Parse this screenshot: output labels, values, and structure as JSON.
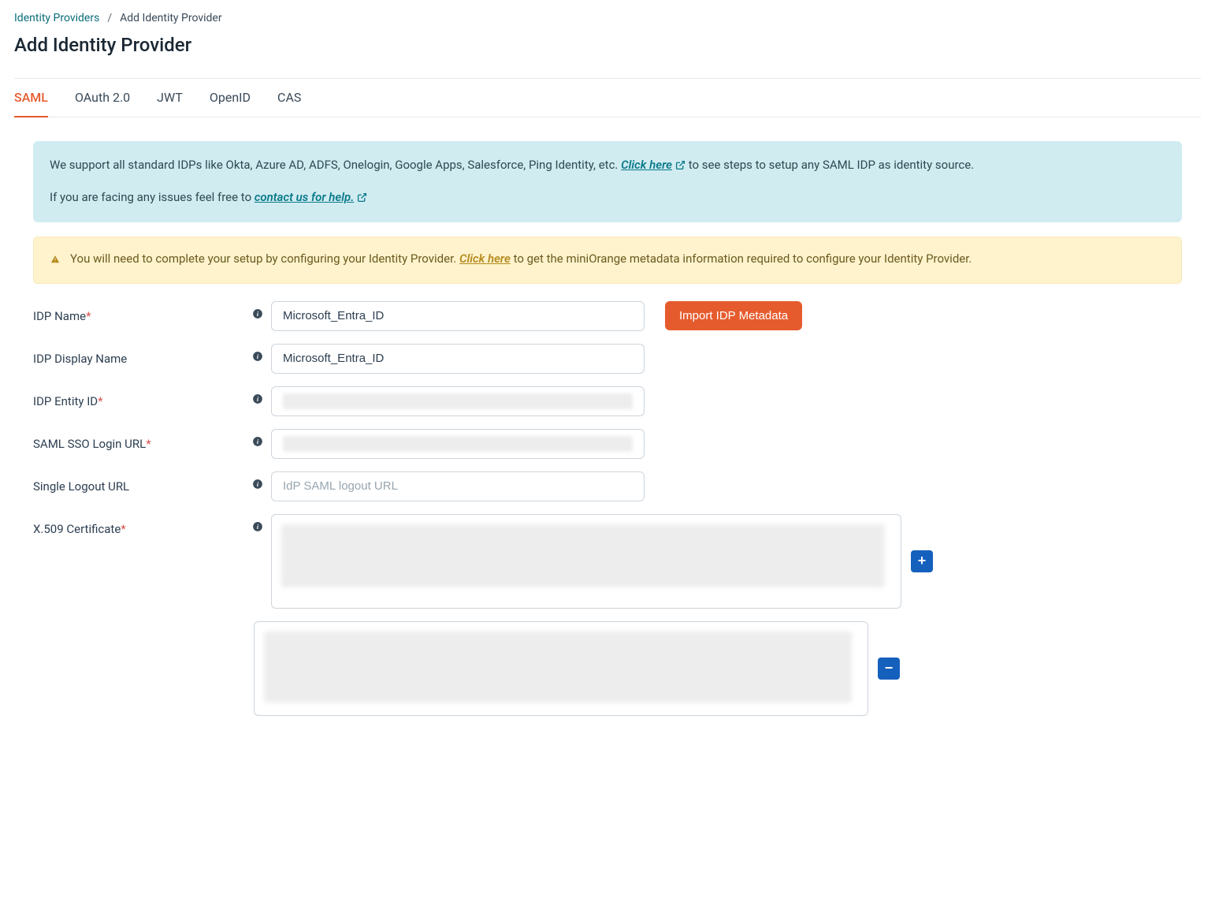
{
  "breadcrumb": {
    "link": "Identity Providers",
    "current": "Add Identity Provider"
  },
  "page_title": "Add Identity Provider",
  "tabs": [
    {
      "id": "saml",
      "label": "SAML",
      "active": true
    },
    {
      "id": "oauth",
      "label": "OAuth 2.0",
      "active": false
    },
    {
      "id": "jwt",
      "label": "JWT",
      "active": false
    },
    {
      "id": "openid",
      "label": "OpenID",
      "active": false
    },
    {
      "id": "cas",
      "label": "CAS",
      "active": false
    }
  ],
  "info_box": {
    "line1_pre": "We support all standard IDPs like Okta, Azure AD, ADFS, Onelogin, Google Apps, Salesforce, Ping Identity, etc. ",
    "link1": "Click here",
    "line1_post": " to see steps to setup any SAML IDP as identity source.",
    "line2_pre": "If you are facing any issues feel free to ",
    "link2": "contact us for help."
  },
  "warning_box": {
    "text_pre": "You will need to complete your setup by configuring your Identity Provider. ",
    "link": "Click here",
    "text_post": " to get the miniOrange metadata information required to configure your Identity Provider."
  },
  "form": {
    "idp_name": {
      "label": "IDP Name",
      "required": true,
      "value": "Microsoft_Entra_ID"
    },
    "idp_display_name": {
      "label": "IDP Display Name",
      "required": false,
      "value": "Microsoft_Entra_ID"
    },
    "idp_entity_id": {
      "label": "IDP Entity ID",
      "required": true,
      "value": ""
    },
    "saml_sso_url": {
      "label": "SAML SSO Login URL",
      "required": true,
      "value": ""
    },
    "logout_url": {
      "label": "Single Logout URL",
      "required": false,
      "placeholder": "IdP SAML logout URL",
      "value": ""
    },
    "x509": {
      "label": "X.509 Certificate",
      "required": true
    }
  },
  "buttons": {
    "import_metadata": "Import IDP Metadata",
    "add": "+",
    "remove": "−"
  }
}
